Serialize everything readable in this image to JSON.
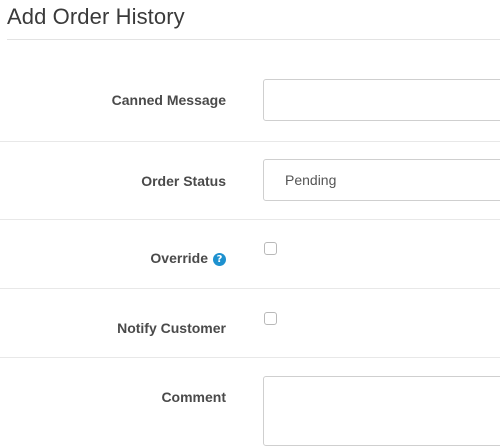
{
  "panel": {
    "title": "Add Order History"
  },
  "form": {
    "canned_message": {
      "label": "Canned Message",
      "value": ""
    },
    "order_status": {
      "label": "Order Status",
      "selected": "Pending"
    },
    "override": {
      "label": "Override",
      "help_icon": "question-circle-icon",
      "help_glyph": "?",
      "checked": false
    },
    "notify_customer": {
      "label": "Notify Customer",
      "checked": false
    },
    "comment": {
      "label": "Comment",
      "value": ""
    }
  },
  "colors": {
    "help_icon": "#1e91cf",
    "divider": "#e8e8e8",
    "label_text": "#4a4a4a"
  }
}
